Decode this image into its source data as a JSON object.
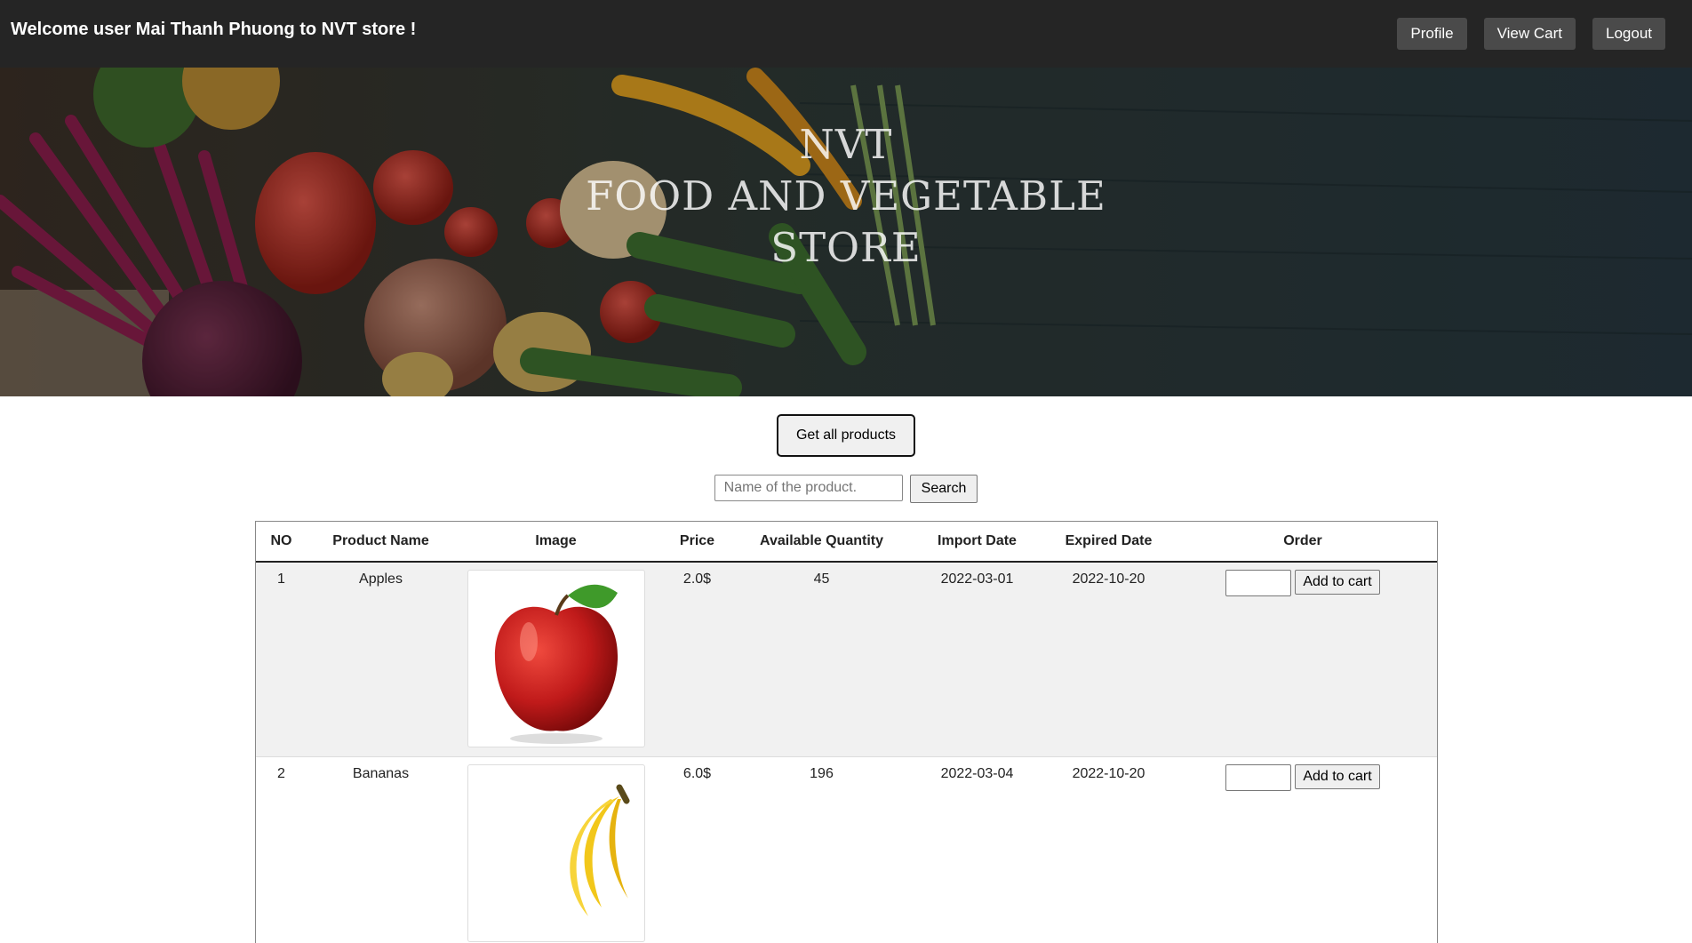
{
  "header": {
    "welcome": "Welcome user Mai Thanh Phuong to NVT store !",
    "nav": {
      "profile": "Profile",
      "view_cart": "View Cart",
      "logout": "Logout"
    }
  },
  "hero": {
    "line1": "NVT",
    "line2": "FOOD AND VEGETABLE",
    "line3": "STORE"
  },
  "controls": {
    "get_all_label": "Get all products",
    "search_placeholder": "Name of the product.",
    "search_label": "Search"
  },
  "table": {
    "headers": [
      "NO",
      "Product Name",
      "Image",
      "Price",
      "Available Quantity",
      "Import Date",
      "Expired Date",
      "Order"
    ],
    "rows": [
      {
        "no": "1",
        "name": "Apples",
        "image": "apple-image",
        "price": "2.0$",
        "quantity": "45",
        "import_date": "2022-03-01",
        "expired_date": "2022-10-20",
        "order_label": "Add to cart"
      },
      {
        "no": "2",
        "name": "Bananas",
        "image": "banana-image",
        "price": "6.0$",
        "quantity": "196",
        "import_date": "2022-03-04",
        "expired_date": "2022-10-20",
        "order_label": "Add to cart"
      }
    ]
  },
  "colors": {
    "topbar": "#252525",
    "nav_button": "#4a4a4a",
    "row_alt": "#f1f1f1"
  }
}
